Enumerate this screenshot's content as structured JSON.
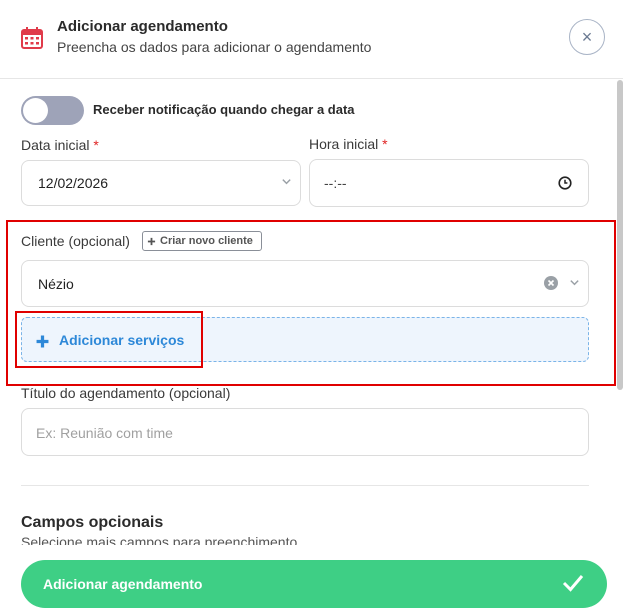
{
  "header": {
    "title": "Adicionar agendamento",
    "subtitle": "Preencha os dados para adicionar o agendamento",
    "icon": "calendar-icon",
    "close_symbol": "×"
  },
  "notification": {
    "label": "Receber notificação quando chegar a data",
    "enabled": false
  },
  "date": {
    "label": "Data inicial",
    "required": "*",
    "value": "12/02/2026"
  },
  "time": {
    "label": "Hora inicial",
    "required": "*",
    "value": "--:--"
  },
  "client": {
    "label": "Cliente (opcional)",
    "create_button": "Criar novo cliente",
    "value": "Nézio"
  },
  "services": {
    "add_label": "Adicionar serviços"
  },
  "appointment_title": {
    "label": "Título do agendamento (opcional)",
    "placeholder": "Ex: Reunião com time"
  },
  "optional_fields": {
    "title": "Campos opcionais",
    "subtitle": "Selecione mais campos para preenchimento"
  },
  "submit": {
    "label": "Adicionar agendamento"
  },
  "colors": {
    "accent_green": "#3ecf85",
    "accent_blue": "#2d88d8",
    "required_red": "#e02424",
    "highlight_red": "#e00000",
    "calendar_icon": "#e03b4a"
  }
}
